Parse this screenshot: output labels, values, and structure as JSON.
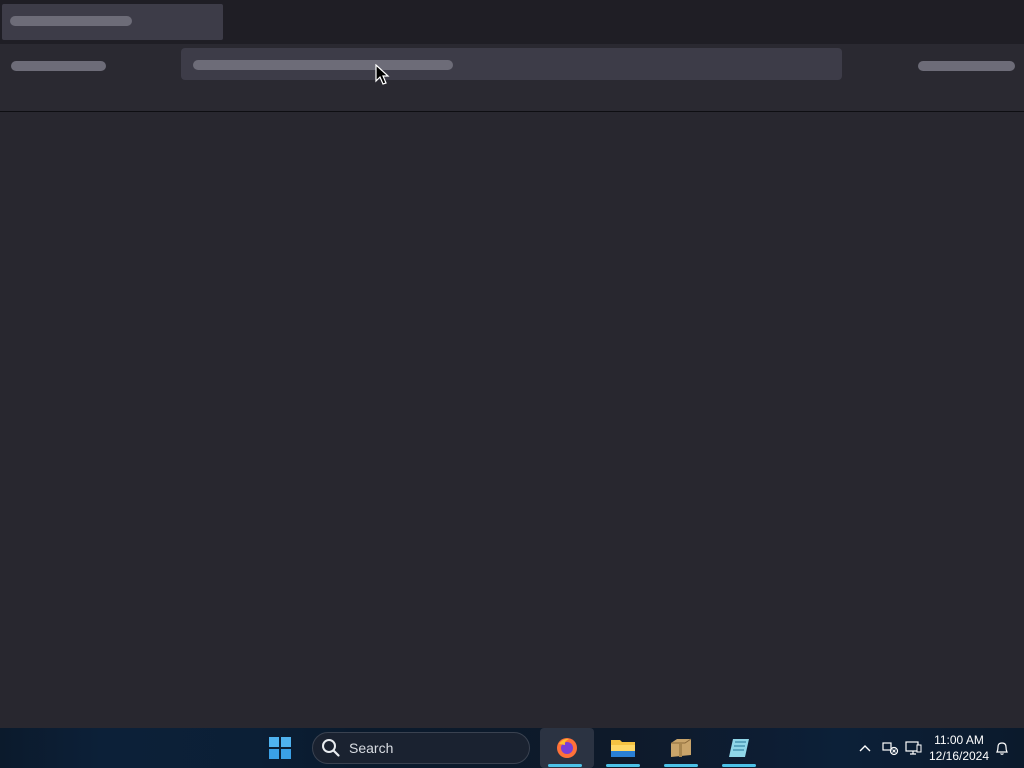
{
  "taskbar": {
    "search_label": "Search",
    "apps": [
      {
        "name": "firefox",
        "active": true
      },
      {
        "name": "file-explorer",
        "active": false
      },
      {
        "name": "archive-box",
        "active": false
      },
      {
        "name": "notepad",
        "active": false
      }
    ],
    "clock": {
      "time": "11:00 AM",
      "date": "12/16/2024"
    }
  },
  "icons": {
    "start": "windows-logo-icon",
    "search": "search-icon",
    "tray_overflow": "chevron-up-icon",
    "network": "network-icon",
    "display": "display-icon",
    "notifications": "bell-icon"
  },
  "colors": {
    "page_bg": "#28272f",
    "tab_bg": "#3d3c48",
    "accent": "#4cc2e8"
  }
}
